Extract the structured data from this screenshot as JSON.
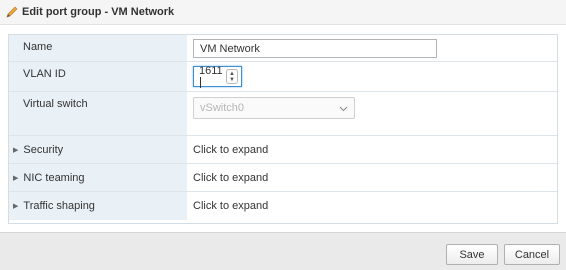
{
  "titlebar": {
    "icon": "pencil-icon",
    "title": "Edit port group - VM Network"
  },
  "form": {
    "name": {
      "label": "Name",
      "value": "VM Network"
    },
    "vlan": {
      "label": "VLAN ID",
      "value": "1611"
    },
    "vswitch": {
      "label": "Virtual switch",
      "value": "vSwitch0",
      "disabled": true
    },
    "sections": [
      {
        "label": "Security",
        "value": "Click to expand"
      },
      {
        "label": "NIC teaming",
        "value": "Click to expand"
      },
      {
        "label": "Traffic shaping",
        "value": "Click to expand"
      }
    ]
  },
  "footer": {
    "save_label": "Save",
    "cancel_label": "Cancel"
  },
  "colors": {
    "label_bg": "#e9f0f6",
    "focus_border": "#3b8fd3",
    "footer_bg": "#eaeaea"
  }
}
